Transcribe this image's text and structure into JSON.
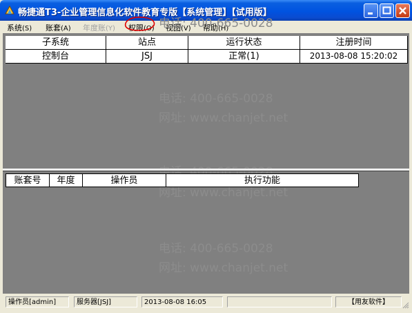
{
  "window": {
    "title": "畅捷通T3-企业管理信息化软件教育专版【系统管理】【试用版】"
  },
  "menu": [
    {
      "label": "系统",
      "key": "(S)",
      "enabled": true
    },
    {
      "label": "账套",
      "key": "(A)",
      "enabled": true
    },
    {
      "label": "年度账",
      "key": "(Y)",
      "enabled": false
    },
    {
      "label": "权限",
      "key": "(O)",
      "enabled": true
    },
    {
      "label": "视图",
      "key": "(V)",
      "enabled": true
    },
    {
      "label": "帮助",
      "key": "(H)",
      "enabled": true
    }
  ],
  "sessions_table": {
    "headers": [
      "子系统",
      "站点",
      "运行状态",
      "注册时间"
    ],
    "rows": [
      [
        "控制台",
        "JSJ",
        "正常(1)",
        "2013-08-08 15:20:02"
      ]
    ]
  },
  "tasks_table": {
    "headers": [
      "账套号",
      "年度",
      "操作员",
      "执行功能"
    ]
  },
  "watermark": {
    "phone": "电话: 400-665-0028",
    "site": "网址: www.chanjet.net"
  },
  "status": {
    "operator": "操作员[admin]",
    "server": "服务器[JSJ]",
    "datetime": "2013-08-08 16:05",
    "vendor": "【用友软件】"
  },
  "colors": {
    "titlebar": "#0053e0",
    "client_bg": "#808080",
    "annotation_circle": "#e00000"
  }
}
